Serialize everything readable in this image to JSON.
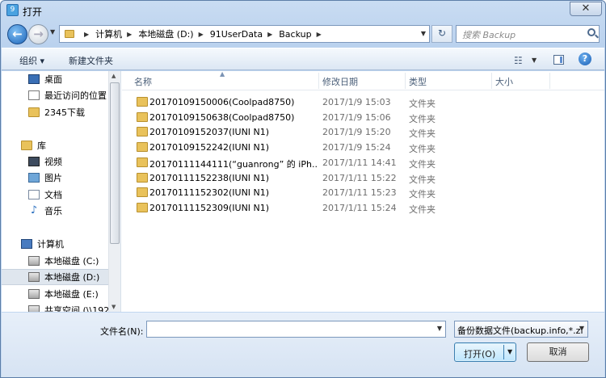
{
  "window": {
    "title": "打开",
    "app_icon": "9",
    "close_label": "✕"
  },
  "navigation": {
    "back_label": "←",
    "forward_label": "→",
    "breadcrumb": [
      "计算机",
      "本地磁盘 (D:)",
      "91UserData",
      "Backup"
    ],
    "refresh_label": "↻",
    "search_placeholder": "搜索 Backup"
  },
  "toolbar": {
    "organize_label": "组织 ▾",
    "new_folder_label": "新建文件夹",
    "view_icon": "☷",
    "help_label": "?"
  },
  "sidebar": {
    "items": [
      {
        "label": "桌面",
        "icon": "desktop-icon"
      },
      {
        "label": "最近访问的位置",
        "icon": "recent-places-icon"
      },
      {
        "label": "2345下载",
        "icon": "folder-icon"
      },
      {
        "label": "库",
        "icon": "library-icon"
      },
      {
        "label": "视频",
        "icon": "video-icon"
      },
      {
        "label": "图片",
        "icon": "pictures-icon"
      },
      {
        "label": "文档",
        "icon": "documents-icon"
      },
      {
        "label": "音乐",
        "icon": "music-icon"
      },
      {
        "label": "计算机",
        "icon": "computer-icon"
      },
      {
        "label": "本地磁盘 (C:)",
        "icon": "drive-icon"
      },
      {
        "label": "本地磁盘 (D:)",
        "icon": "drive-icon",
        "selected": true
      },
      {
        "label": "本地磁盘 (E:)",
        "icon": "drive-icon"
      },
      {
        "label": "共享空间 (\\\\192",
        "icon": "network-drive-icon"
      }
    ]
  },
  "file_list": {
    "columns": [
      "名称",
      "修改日期",
      "类型",
      "大小"
    ],
    "rows": [
      {
        "name": "20170109150006(Coolpad8750)",
        "date": "2017/1/9 15:03",
        "type": "文件夹"
      },
      {
        "name": "20170109150638(Coolpad8750)",
        "date": "2017/1/9 15:06",
        "type": "文件夹"
      },
      {
        "name": "20170109152037(IUNI N1)",
        "date": "2017/1/9 15:20",
        "type": "文件夹"
      },
      {
        "name": "20170109152242(IUNI N1)",
        "date": "2017/1/9 15:24",
        "type": "文件夹"
      },
      {
        "name": "20170111144111(“guanrong” 的 iPh...",
        "date": "2017/1/11 14:41",
        "type": "文件夹"
      },
      {
        "name": "20170111152238(IUNI N1)",
        "date": "2017/1/11 15:22",
        "type": "文件夹"
      },
      {
        "name": "20170111152302(IUNI N1)",
        "date": "2017/1/11 15:23",
        "type": "文件夹"
      },
      {
        "name": "20170111152309(IUNI N1)",
        "date": "2017/1/11 15:24",
        "type": "文件夹"
      }
    ]
  },
  "footer": {
    "filename_label": "文件名(N):",
    "filename_value": "",
    "filetype_value": "备份数据文件(backup.info,*.zi",
    "open_label": "打开(O)",
    "cancel_label": "取消"
  }
}
